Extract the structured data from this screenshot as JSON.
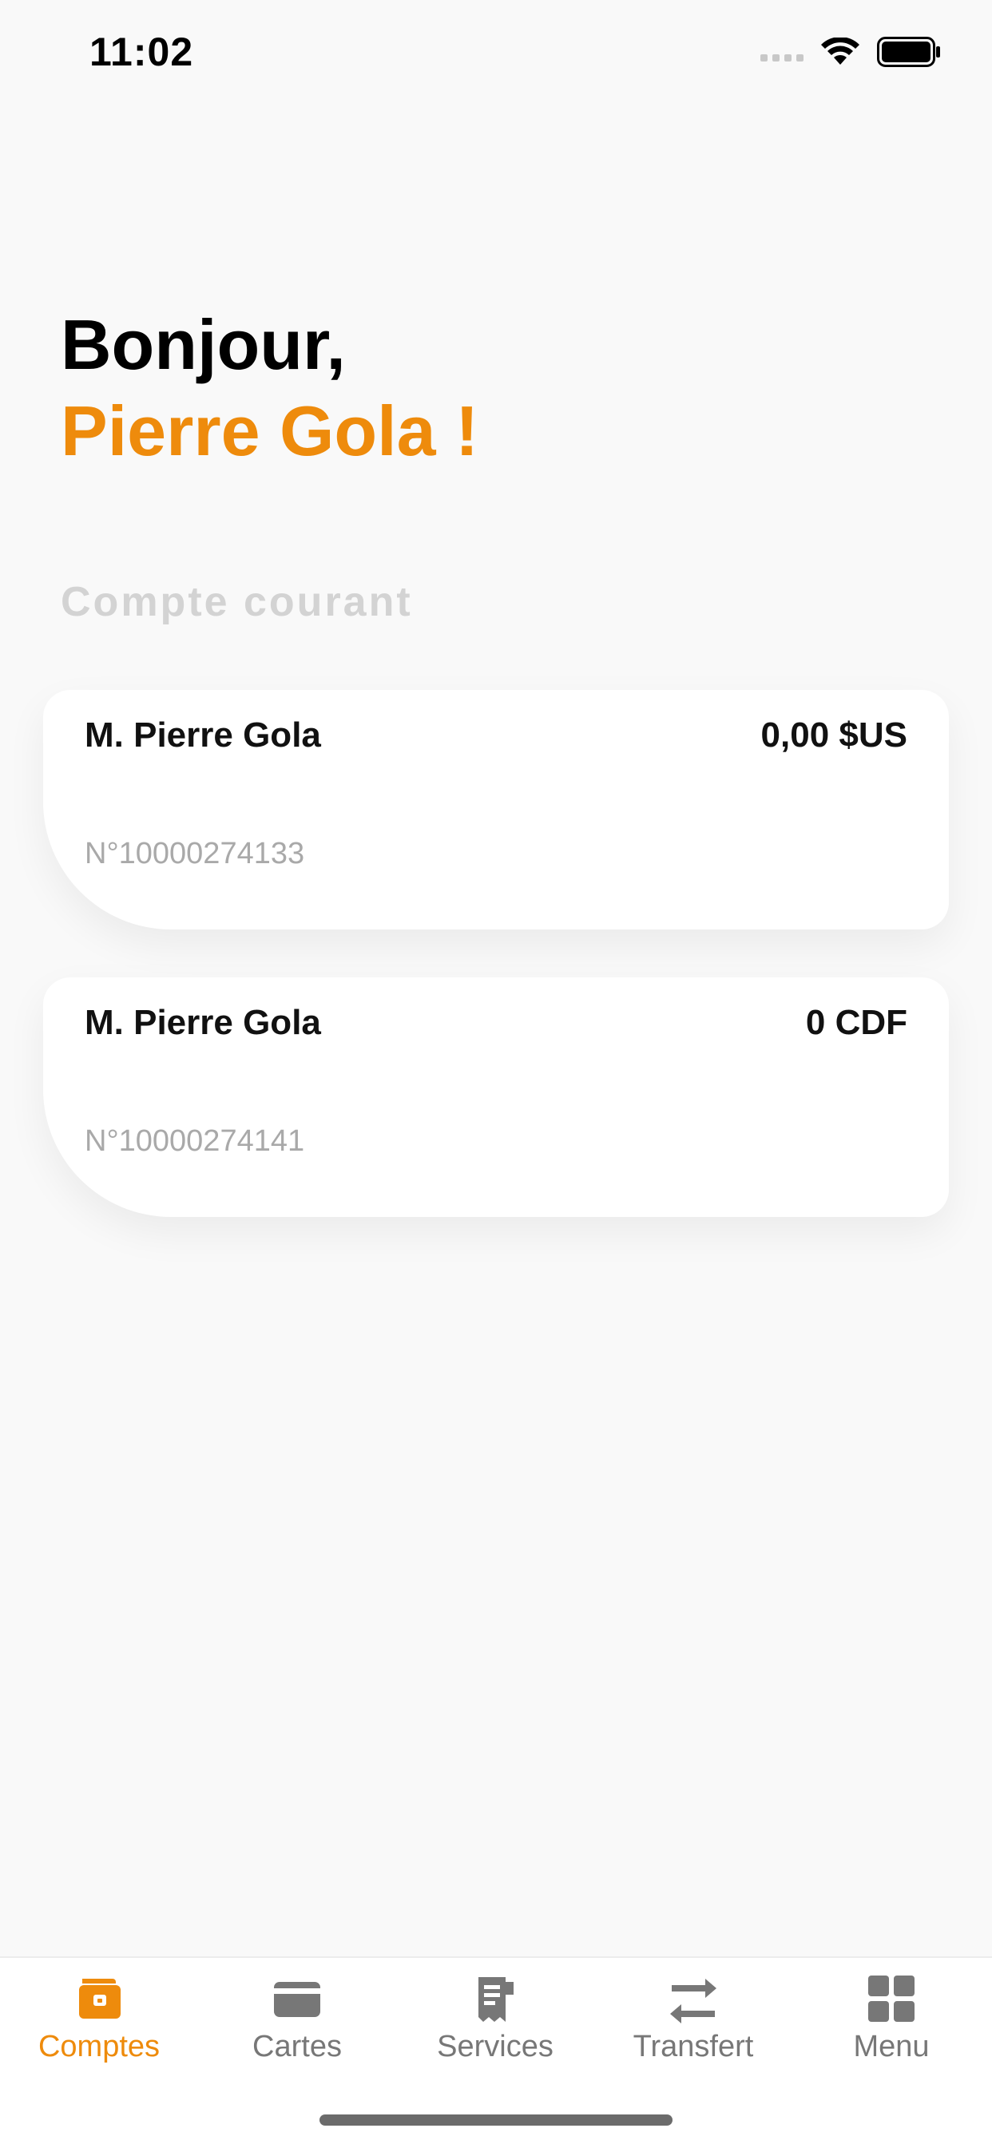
{
  "status_bar": {
    "time": "11:02"
  },
  "greeting": {
    "hello": "Bonjour,",
    "name": "Pierre Gola !"
  },
  "section": {
    "label": "Compte courant"
  },
  "accounts": [
    {
      "holder": "M. Pierre Gola",
      "balance": "0,00 $US",
      "number": "N°10000274133"
    },
    {
      "holder": "M. Pierre Gola",
      "balance": "0 CDF",
      "number": "N°10000274141"
    }
  ],
  "tab_bar": {
    "items": [
      {
        "label": "Comptes",
        "icon": "wallet-icon",
        "active": true
      },
      {
        "label": "Cartes",
        "icon": "card-icon",
        "active": false
      },
      {
        "label": "Services",
        "icon": "receipt-icon",
        "active": false
      },
      {
        "label": "Transfert",
        "icon": "transfer-arrows-icon",
        "active": false
      },
      {
        "label": "Menu",
        "icon": "grid-icon",
        "active": false
      }
    ]
  },
  "colors": {
    "accent": "#ee8b0c",
    "inactive": "#777777",
    "background": "#f9f9f9"
  }
}
